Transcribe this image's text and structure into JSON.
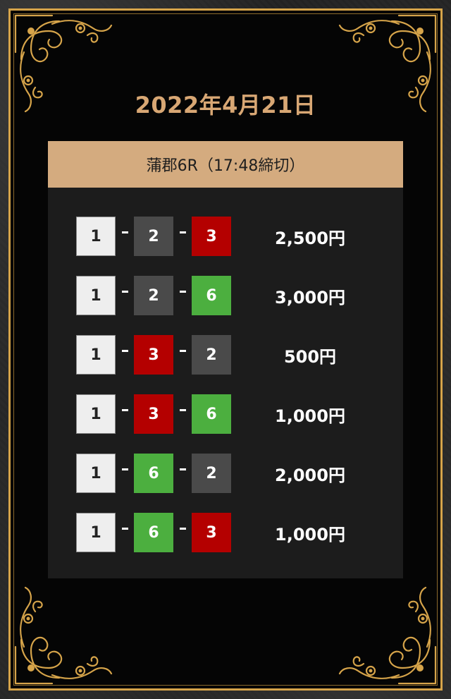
{
  "date": "2022年4月21日",
  "race": "蒲郡6R（17:48締切）",
  "bets": [
    {
      "boats": [
        "1",
        "2",
        "3"
      ],
      "amount": "2,500円"
    },
    {
      "boats": [
        "1",
        "2",
        "6"
      ],
      "amount": "3,000円"
    },
    {
      "boats": [
        "1",
        "3",
        "2"
      ],
      "amount": "500円"
    },
    {
      "boats": [
        "1",
        "3",
        "6"
      ],
      "amount": "1,000円"
    },
    {
      "boats": [
        "1",
        "6",
        "2"
      ],
      "amount": "2,000円"
    },
    {
      "boats": [
        "1",
        "6",
        "3"
      ],
      "amount": "1,000円"
    }
  ],
  "colors": {
    "gold": "#d6a44a",
    "date": "#d8a774",
    "header_bg": "#d4ab7f",
    "boat_1": "#eeeeee",
    "boat_2": "#4a4a4a",
    "boat_3": "#b40000",
    "boat_6": "#4caf3f"
  },
  "icons": {
    "corner_ornament": "gold-flourish-corner-icon"
  }
}
